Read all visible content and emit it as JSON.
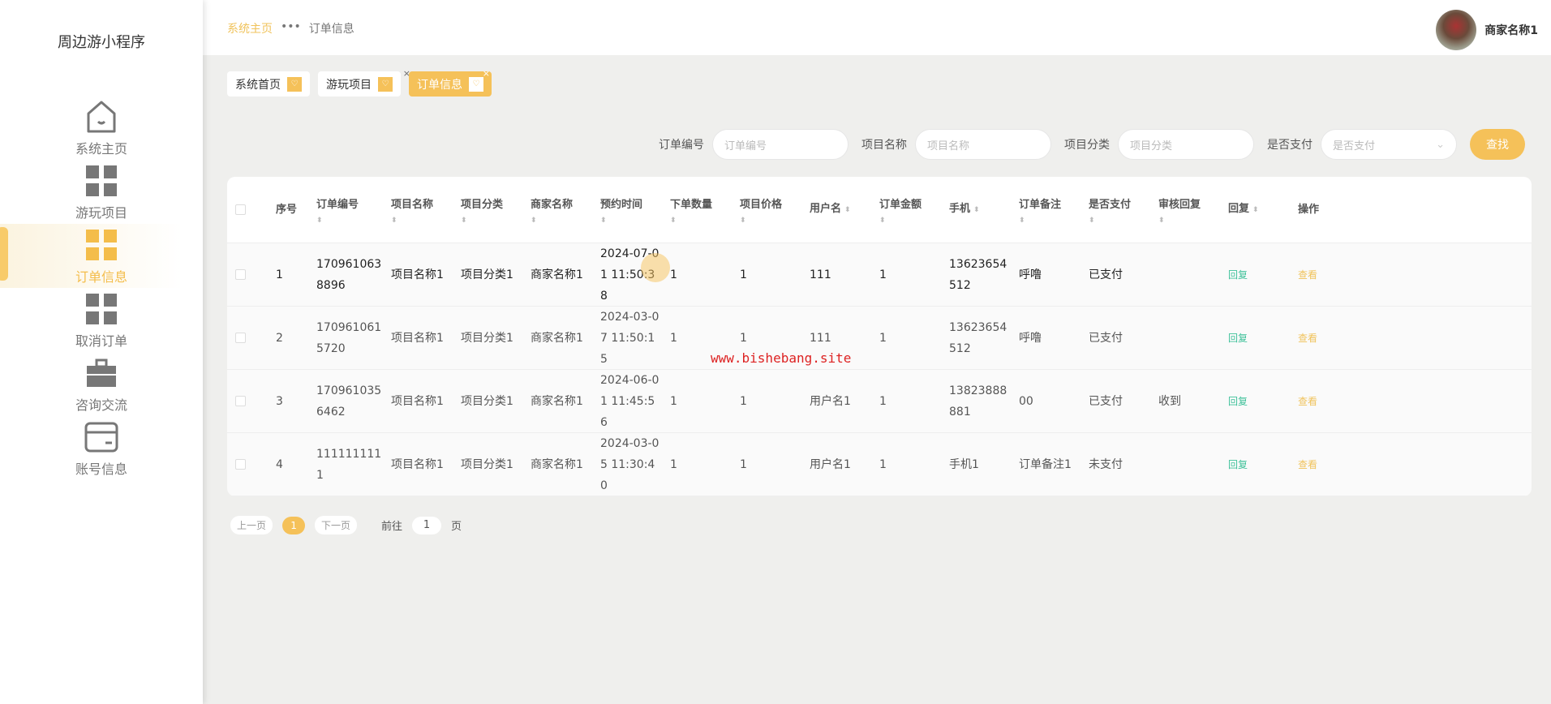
{
  "app": {
    "title": "周边游小程序"
  },
  "sidebar": {
    "items": [
      {
        "label": "系统主页",
        "icon": "home-icon"
      },
      {
        "label": "游玩项目",
        "icon": "grid-icon"
      },
      {
        "label": "订单信息",
        "icon": "grid-icon",
        "active": true
      },
      {
        "label": "取消订单",
        "icon": "grid-icon"
      },
      {
        "label": "咨询交流",
        "icon": "briefcase-icon"
      },
      {
        "label": "账号信息",
        "icon": "card-icon"
      }
    ]
  },
  "header": {
    "breadcrumb": {
      "home": "系统主页",
      "sep": "•••",
      "current": "订单信息"
    },
    "user": "商家名称1"
  },
  "tabs": [
    {
      "label": "系统首页"
    },
    {
      "label": "游玩项目"
    },
    {
      "label": "订单信息",
      "active": true
    }
  ],
  "search": {
    "fields": [
      {
        "label": "订单编号",
        "placeholder": "订单编号"
      },
      {
        "label": "项目名称",
        "placeholder": "项目名称"
      },
      {
        "label": "项目分类",
        "placeholder": "项目分类"
      },
      {
        "label": "是否支付",
        "placeholder": "是否支付"
      }
    ],
    "button": "查找"
  },
  "table": {
    "columns": [
      "序号",
      "订单编号",
      "项目名称",
      "项目分类",
      "商家名称",
      "预约时间",
      "下单数量",
      "项目价格",
      "用户名",
      "订单金额",
      "手机",
      "订单备注",
      "是否支付",
      "审核回复",
      "回复",
      "操作"
    ],
    "rows": [
      [
        "1",
        "1709610638896",
        "项目名称1",
        "项目分类1",
        "商家名称1",
        "2024-07-01 11:50:38",
        "1",
        "1",
        "111",
        "1",
        "13623654512",
        "呼噜",
        "已支付",
        ""
      ],
      [
        "2",
        "1709610615720",
        "项目名称1",
        "项目分类1",
        "商家名称1",
        "2024-03-07 11:50:15",
        "1",
        "1",
        "111",
        "1",
        "13623654512",
        "呼噜",
        "已支付",
        ""
      ],
      [
        "3",
        "1709610356462",
        "项目名称1",
        "项目分类1",
        "商家名称1",
        "2024-06-01 11:45:56",
        "1",
        "1",
        "用户名1",
        "1",
        "13823888881",
        "00",
        "已支付",
        "收到"
      ],
      [
        "4",
        "1111111111",
        "项目名称1",
        "项目分类1",
        "商家名称1",
        "2024-03-05 11:30:40",
        "1",
        "1",
        "用户名1",
        "1",
        "手机1",
        "订单备注1",
        "未支付",
        ""
      ]
    ],
    "reply_label": "回复",
    "view_label": "查看"
  },
  "pagination": {
    "prev": "上一页",
    "current": "1",
    "next": "下一页",
    "goto_prefix": "前往",
    "goto_value": "1",
    "goto_suffix": "页"
  },
  "watermark": "www.bishebang.site",
  "colors": {
    "accent": "#f5c159",
    "reply": "#3fc19a"
  }
}
